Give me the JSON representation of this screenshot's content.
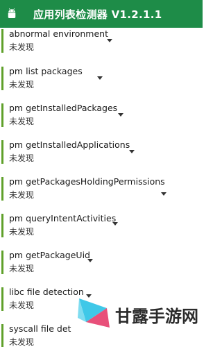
{
  "app": {
    "title": "应用列表检测器 V1.2.1.1"
  },
  "items": [
    {
      "name": "abnormal environment",
      "status": "未发现"
    },
    {
      "name": "pm list packages",
      "status": "未发现"
    },
    {
      "name": "pm getInstalledPackages",
      "status": "未发现"
    },
    {
      "name": "pm getInstalledApplications",
      "status": "未发现"
    },
    {
      "name": "pm getPackagesHoldingPermissions",
      "status": "未发现"
    },
    {
      "name": "pm queryIntentActivities",
      "status": "未发现"
    },
    {
      "name": "pm getPackageUid",
      "status": "未发现"
    },
    {
      "name": "libc file detection",
      "status": "未发现"
    },
    {
      "name": "syscall file det",
      "status": "未发现"
    }
  ],
  "watermark": {
    "text": "甘露手游网"
  },
  "colors": {
    "appbar": "#1e8c48",
    "accent_bar": "#5fa02a",
    "logo_pink": "#e8507a",
    "logo_cyan": "#3fc8e8"
  },
  "icons": {
    "app_icon": "android-icon",
    "expand": "caret-down-icon",
    "watermark_logo": "ganlu-logo"
  }
}
